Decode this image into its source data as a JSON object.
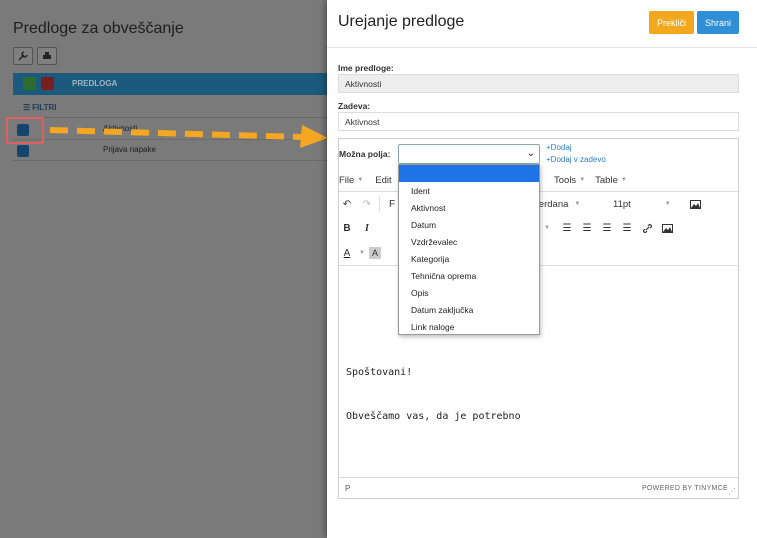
{
  "background": {
    "title": "Predloge za obveščanje",
    "column_title": "PREDLOGA",
    "filters_label": "FILTRI",
    "rows": [
      {
        "label": "Aktivnosti"
      },
      {
        "label": "Prijava napake"
      }
    ]
  },
  "modal": {
    "title": "Urejanje predloge",
    "cancel_label": "Prekliči",
    "save_label": "Shrani",
    "name_label": "Ime predloge:",
    "name_value": "Aktivnosti",
    "subject_label": "Zadeva:",
    "subject_value": "Aktivnost",
    "fields_label": "Možna polja:",
    "add_label": "+Dodaj",
    "add_subject_label": "+Dodaj v zadevo",
    "dropdown_options": [
      "Ident",
      "Aktivnost",
      "Datum",
      "Vzdrževalec",
      "Kategorija",
      "Tehnična oprema",
      "Opis",
      "Datum zaključka",
      "Link naloge"
    ]
  },
  "editor": {
    "menu": [
      "File",
      "Edit",
      "Tools",
      "Table"
    ],
    "font_family": "Verdana",
    "font_size": "11pt",
    "content_lines": [
      "Spoštovani!",
      "Obveščamo vas, da je potrebno"
    ],
    "status_path": "P",
    "powered_by": "POWERED BY TINYMCE"
  },
  "colors": {
    "cancel": "#f3a71c",
    "save": "#2f8fd6",
    "arrow": "#f5a623",
    "highlight": "#e06060"
  }
}
